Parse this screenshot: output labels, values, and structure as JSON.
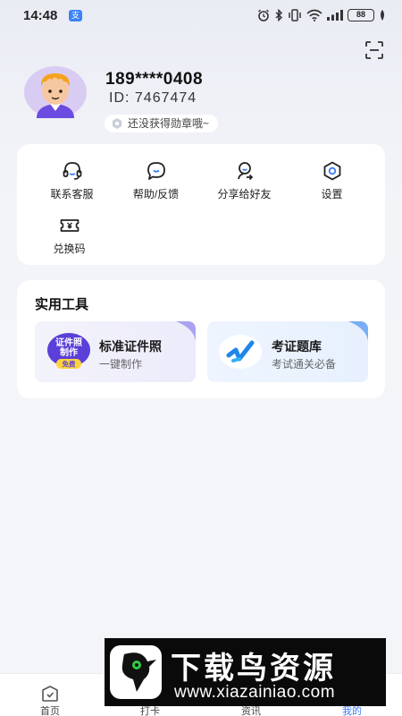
{
  "status_bar": {
    "time": "14:48",
    "app_badge": "支",
    "battery": "88"
  },
  "profile": {
    "phone": "189****0408",
    "id_text": "ID:  7467474",
    "medal_text": "还没获得勋章哦~"
  },
  "quick_actions": [
    {
      "label": "联系客服",
      "icon": "headset-icon"
    },
    {
      "label": "帮助/反馈",
      "icon": "chat-bubble-icon"
    },
    {
      "label": "分享给好友",
      "icon": "share-user-icon"
    },
    {
      "label": "设置",
      "icon": "gear-icon"
    },
    {
      "label": "兑换码",
      "icon": "ticket-icon"
    }
  ],
  "tools": {
    "title": "实用工具",
    "items": [
      {
        "title": "标准证件照",
        "subtitle": "一键制作",
        "logo_line1": "证件照",
        "logo_line2": "制作",
        "logo_tag": "免费"
      },
      {
        "title": "考证题库",
        "subtitle": "考试通关必备"
      }
    ]
  },
  "bottom_nav": [
    {
      "label": "首页",
      "icon": "home-icon",
      "active": false
    },
    {
      "label": "打卡",
      "icon": "checkin-icon",
      "active": false
    },
    {
      "label": "资讯",
      "icon": "news-icon",
      "active": false
    },
    {
      "label": "我的",
      "icon": "profile-icon",
      "active": true
    }
  ],
  "watermark": {
    "title": "下载鸟资源",
    "url": "www.xiazainiao.com"
  },
  "colors": {
    "accent": "#3f7cf5",
    "card": "#ffffff",
    "background": "#f4f5f9"
  }
}
